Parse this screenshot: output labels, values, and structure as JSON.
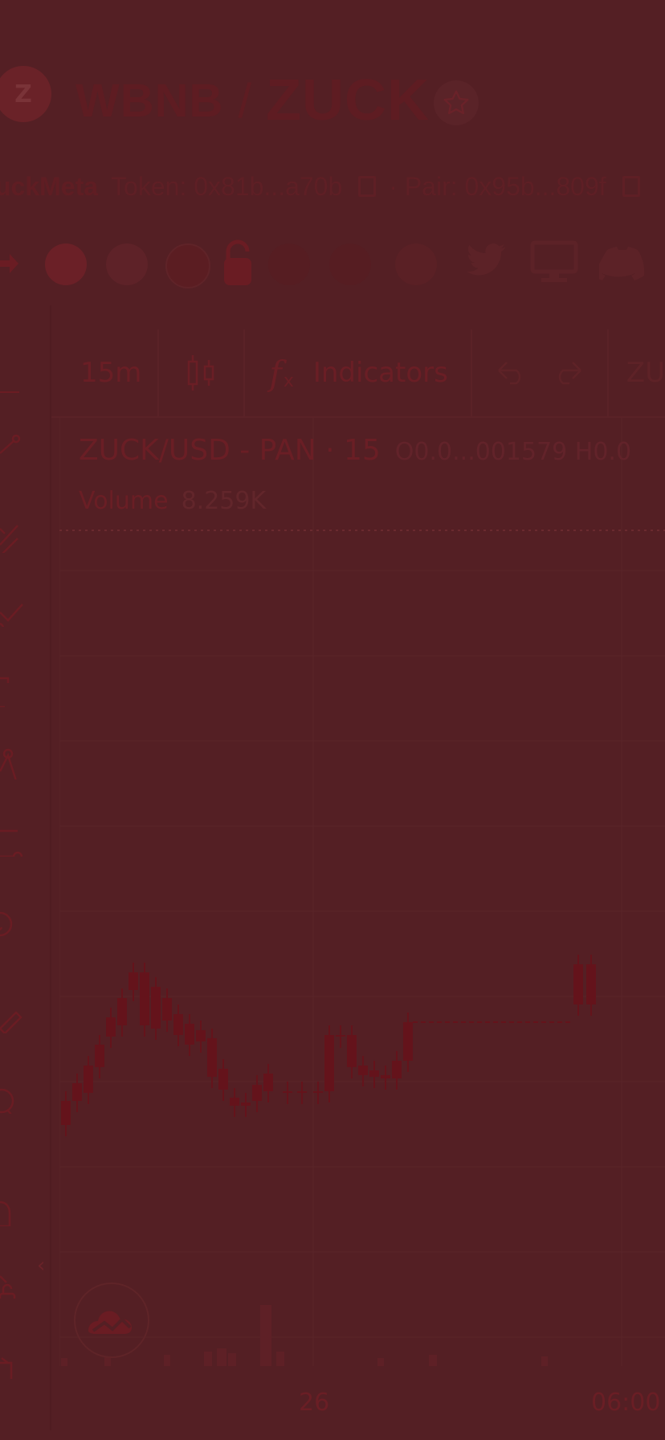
{
  "header": {
    "avatar_letter": "Z",
    "pair_base": "WBNB",
    "pair_separator": "/",
    "pair_quote": "ZUCK",
    "token_name": "uckMeta",
    "token_label": "Token: 0x81b...a70b",
    "pair_label": "· Pair: 0x95b...809f"
  },
  "toolbar": {
    "interval": "15m",
    "indicators_label": "Indicators",
    "fx_symbol": "f",
    "symbol_cut": "ZU"
  },
  "legend": {
    "symbol": "ZUCK/USD - PAN · 15",
    "ohlc": "O0.0...001579 H0.0",
    "volume_label": "Volume",
    "volume_value": "8.259K"
  },
  "axis": {
    "time_labels": [
      "26",
      "06:00"
    ]
  },
  "colors": {
    "overlay": "#541f24",
    "candle": "#64131b",
    "grid": "#5a2429"
  }
}
